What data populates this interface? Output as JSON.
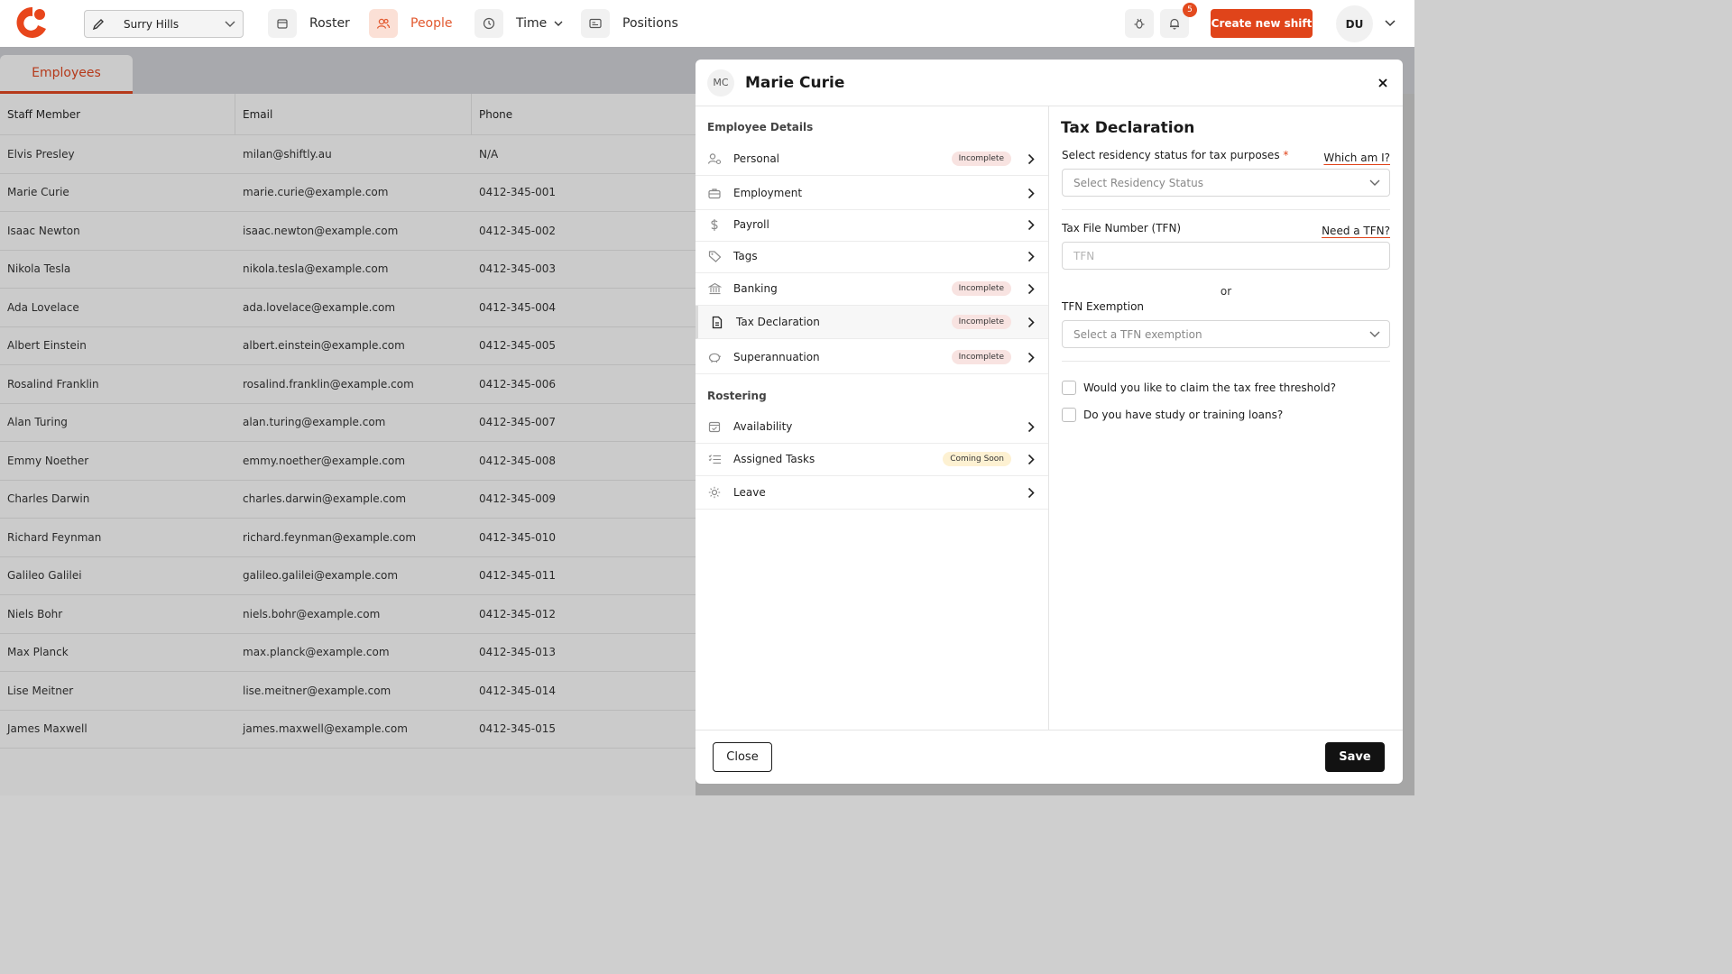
{
  "nav": {
    "location": "Surry Hills",
    "items": [
      {
        "label": "Roster",
        "icon": "calendar-icon"
      },
      {
        "label": "People",
        "icon": "people-icon"
      },
      {
        "label": "Time",
        "icon": "clock-icon"
      },
      {
        "label": "Positions",
        "icon": "id-card-icon"
      }
    ],
    "notification_count": "5",
    "create_label": "Create new shift",
    "user_initials": "DU"
  },
  "employees": {
    "tab_label": "Employees",
    "columns": [
      "Staff Member",
      "Email",
      "Phone"
    ],
    "rows": [
      [
        "Elvis Presley",
        "milan@shiftly.au",
        "N/A"
      ],
      [
        "Marie Curie",
        "marie.curie@example.com",
        "0412-345-001"
      ],
      [
        "Isaac Newton",
        "isaac.newton@example.com",
        "0412-345-002"
      ],
      [
        "Nikola Tesla",
        "nikola.tesla@example.com",
        "0412-345-003"
      ],
      [
        "Ada Lovelace",
        "ada.lovelace@example.com",
        "0412-345-004"
      ],
      [
        "Albert Einstein",
        "albert.einstein@example.com",
        "0412-345-005"
      ],
      [
        "Rosalind Franklin",
        "rosalind.franklin@example.com",
        "0412-345-006"
      ],
      [
        "Alan Turing",
        "alan.turing@example.com",
        "0412-345-007"
      ],
      [
        "Emmy Noether",
        "emmy.noether@example.com",
        "0412-345-008"
      ],
      [
        "Charles Darwin",
        "charles.darwin@example.com",
        "0412-345-009"
      ],
      [
        "Richard Feynman",
        "richard.feynman@example.com",
        "0412-345-010"
      ],
      [
        "Galileo Galilei",
        "galileo.galilei@example.com",
        "0412-345-011"
      ],
      [
        "Niels Bohr",
        "niels.bohr@example.com",
        "0412-345-012"
      ],
      [
        "Max Planck",
        "max.planck@example.com",
        "0412-345-013"
      ],
      [
        "Lise Meitner",
        "lise.meitner@example.com",
        "0412-345-014"
      ],
      [
        "James Maxwell",
        "james.maxwell@example.com",
        "0412-345-015"
      ]
    ]
  },
  "panel": {
    "initials": "MC",
    "name": "Marie Curie",
    "sections": {
      "details": "Employee Details",
      "rostering": "Rostering"
    },
    "detail_items": [
      {
        "label": "Personal",
        "icon": "user-settings-icon",
        "status": "Incomplete"
      },
      {
        "label": "Employment",
        "icon": "briefcase-icon",
        "status": ""
      },
      {
        "label": "Payroll",
        "icon": "dollar-icon",
        "status": ""
      },
      {
        "label": "Tags",
        "icon": "tag-icon",
        "status": ""
      },
      {
        "label": "Banking",
        "icon": "bank-icon",
        "status": "Incomplete"
      },
      {
        "label": "Tax Declaration",
        "icon": "document-icon",
        "status": "Incomplete"
      },
      {
        "label": "Superannuation",
        "icon": "piggy-bank-icon",
        "status": "Incomplete"
      }
    ],
    "roster_items": [
      {
        "label": "Availability",
        "icon": "calendar-check-icon",
        "status": ""
      },
      {
        "label": "Assigned Tasks",
        "icon": "task-list-icon",
        "status": "Coming Soon"
      },
      {
        "label": "Leave",
        "icon": "sun-icon",
        "status": ""
      }
    ],
    "form": {
      "title": "Tax Declaration",
      "residency_label": "Select residency status for tax purposes",
      "required_mark": "*",
      "residency_link": "Which am I?",
      "residency_placeholder": "Select Residency Status",
      "tfn_label": "Tax File Number (TFN)",
      "tfn_link": "Need a TFN?",
      "tfn_placeholder": "TFN",
      "or_text": "or",
      "exemption_label": "TFN Exemption",
      "exemption_placeholder": "Select a TFN exemption",
      "threshold_label": "Would you like to claim the tax free threshold?",
      "loans_label": "Do you have study or training loans?"
    },
    "close_label": "Close",
    "save_label": "Save"
  },
  "colors": {
    "accent": "#e0441a",
    "accent_text": "#e2582e",
    "dark_button": "#121212"
  }
}
